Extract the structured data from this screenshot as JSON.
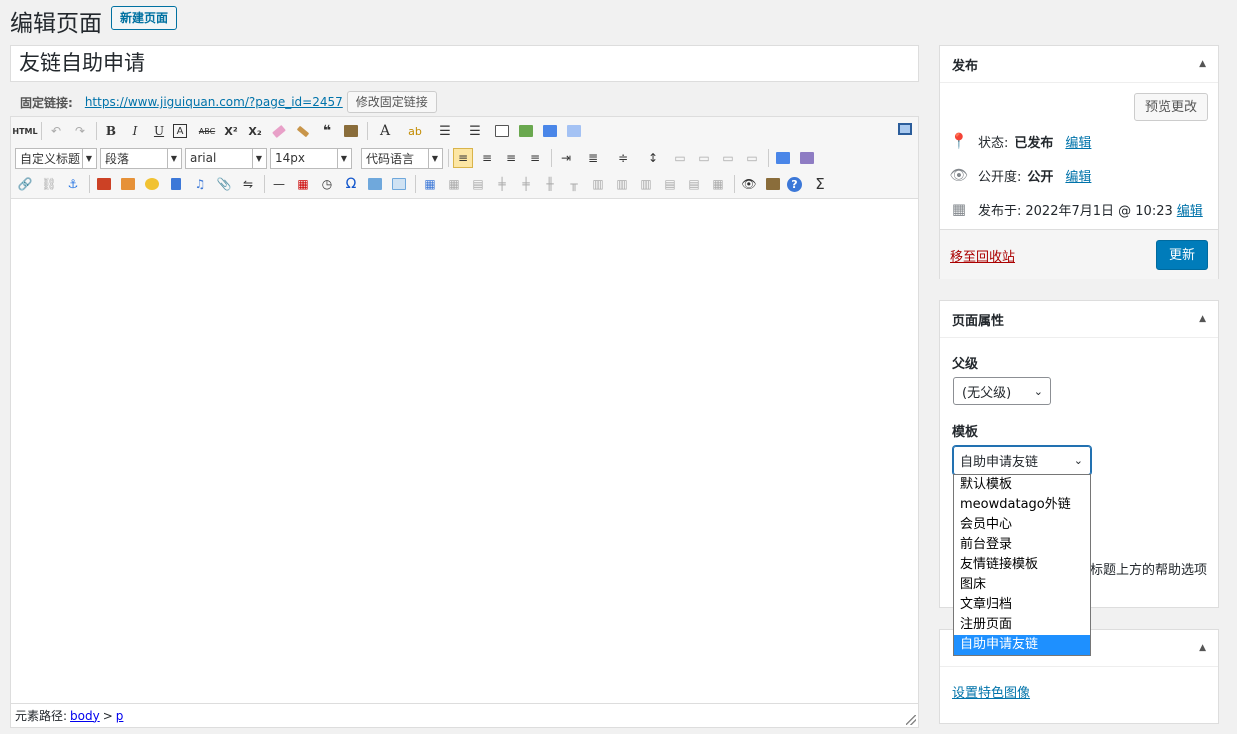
{
  "header": {
    "title": "编辑页面",
    "new_page_label": "新建页面"
  },
  "post": {
    "title": "友链自助申请"
  },
  "permalink": {
    "label": "固定链接:",
    "url": "https://www.jiguiquan.com/?page_id=2457",
    "edit_label": "修改固定链接"
  },
  "toolbar": {
    "html_label": "HTML",
    "row1": [
      "B",
      "I",
      "U",
      "A",
      "ABC",
      "X²",
      "X₂",
      "A",
      "ab"
    ],
    "format_select": "自定义标题",
    "paragraph_select": "段落",
    "font_select": "arial",
    "size_select": "14px",
    "code_select": "代码语言",
    "omega": "Ω",
    "sigma": "Σ",
    "help": "?"
  },
  "statusbar": {
    "label": "元素路径:",
    "path": [
      "body",
      "p"
    ],
    "sep": ">"
  },
  "publish": {
    "title": "发布",
    "preview_label": "预览更改",
    "status_label": "状态:",
    "status_value": "已发布",
    "visibility_label": "公开度:",
    "visibility_value": "公开",
    "date_label": "发布于:",
    "date_value": "2022年7月1日 @ 10:23",
    "edit_link": "编辑",
    "trash_label": "移至回收站",
    "update_label": "更新"
  },
  "attributes": {
    "title": "页面属性",
    "parent_label": "父级",
    "parent_value": "(无父级)",
    "template_label": "模板",
    "template_value": "自助申请友链",
    "help_hint": "标题上方的帮助选项",
    "template_options": [
      "默认模板",
      "meowdatago外链",
      "会员中心",
      "前台登录",
      "友情链接模板",
      "图床",
      "文章归档",
      "注册页面",
      "自助申请友链"
    ],
    "selected_index": 8
  },
  "featured": {
    "link_label": "设置特色图像"
  },
  "colors": {
    "accent": "#007cba",
    "selected_option": "#1e90ff",
    "trash": "#a00"
  }
}
